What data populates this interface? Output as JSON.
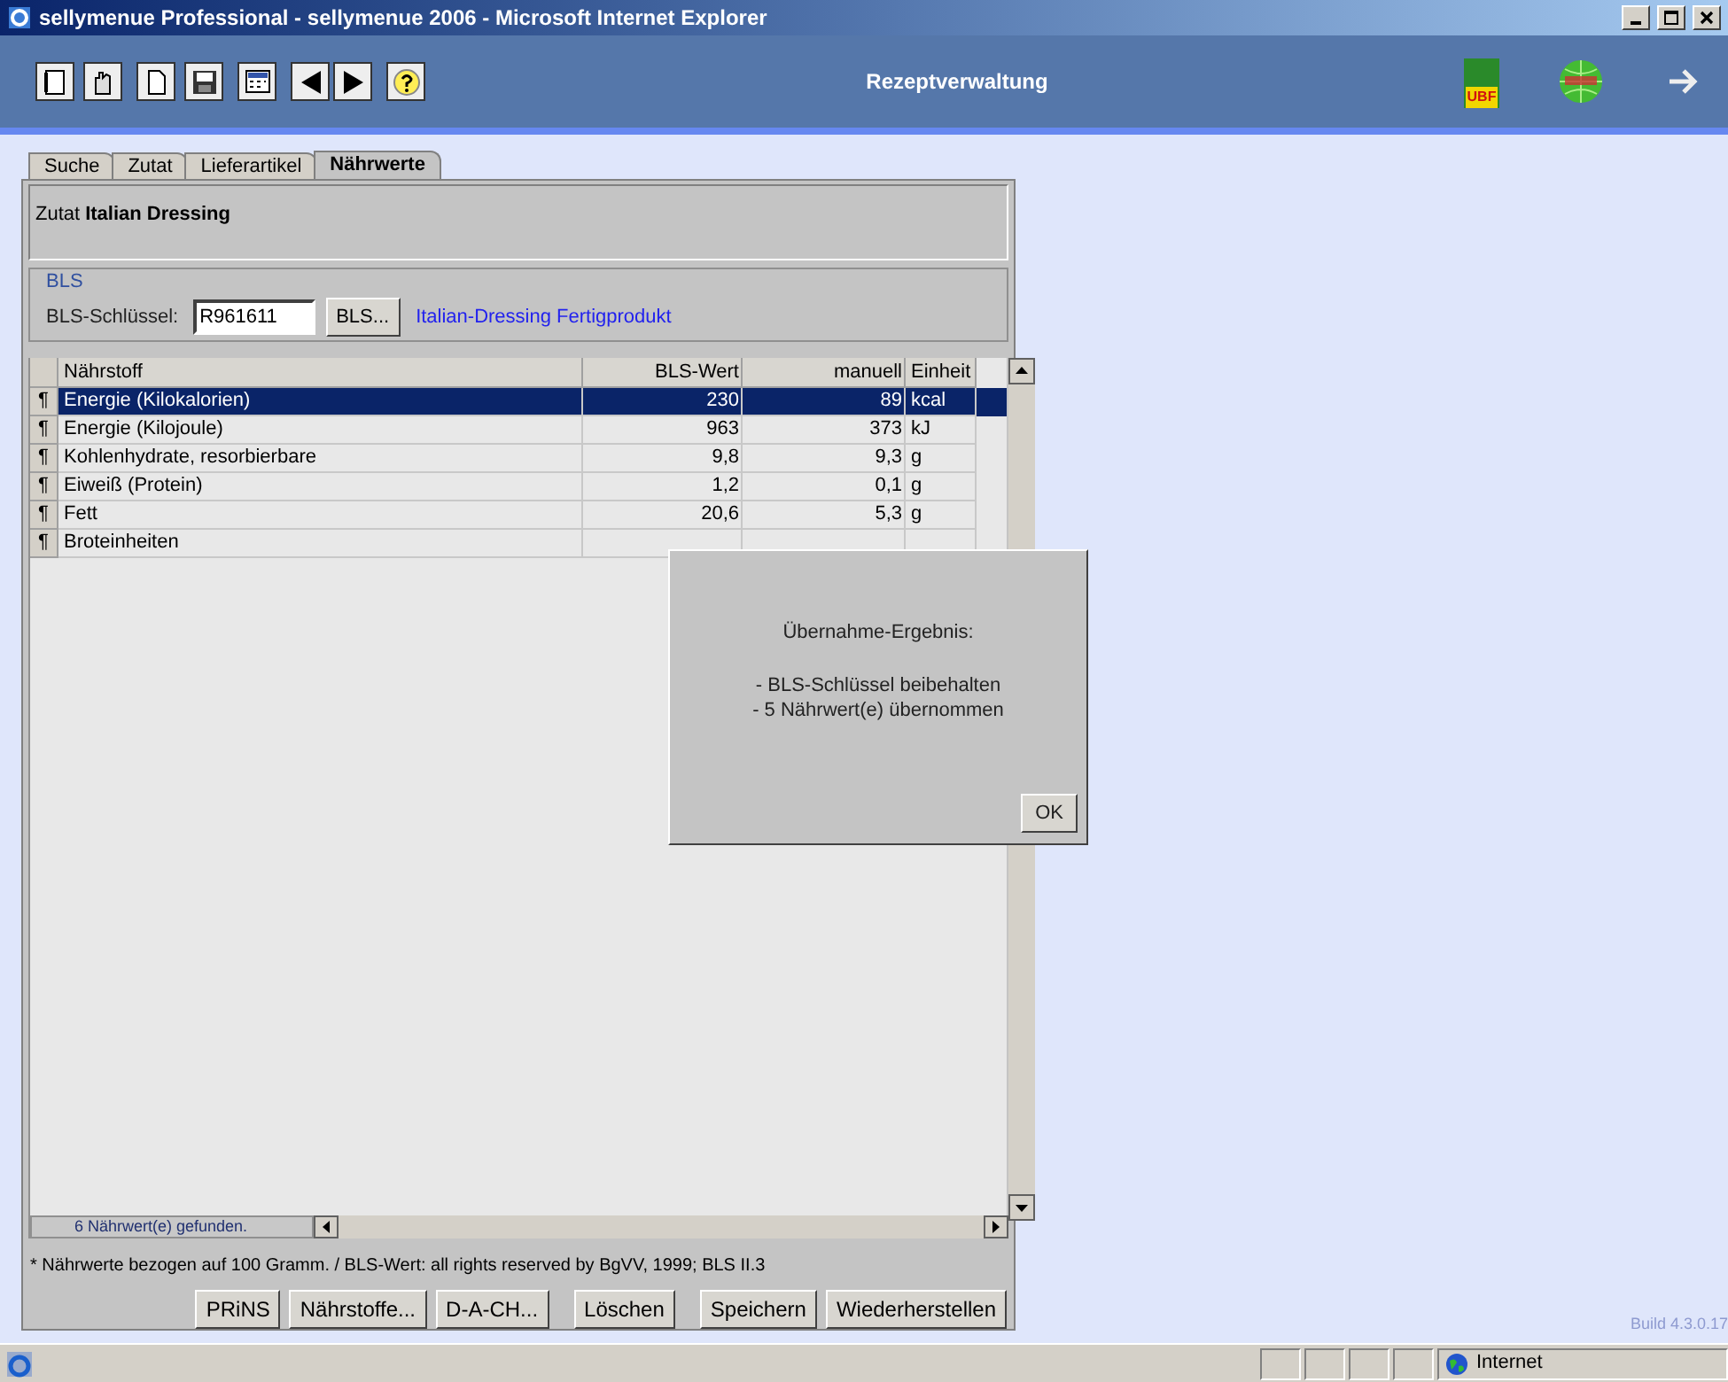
{
  "window": {
    "title": "sellymenue Professional - sellymenue 2006 - Microsoft Internet Explorer"
  },
  "header": {
    "title": "Rezeptverwaltung",
    "logo_text": "UBF"
  },
  "tabs": [
    {
      "label": "Suche",
      "selected": false
    },
    {
      "label": "Zutat",
      "selected": false
    },
    {
      "label": "Lieferartikel",
      "selected": false
    },
    {
      "label": "Nährwerte",
      "selected": true
    }
  ],
  "ingredient": {
    "label": "Zutat",
    "name": "Italian Dressing"
  },
  "bls": {
    "legend": "BLS",
    "key_label": "BLS-Schlüssel:",
    "key_value": "R961611",
    "button": "BLS...",
    "description": "Italian-Dressing Fertigprodukt"
  },
  "table": {
    "columns": [
      "Nährstoff",
      "BLS-Wert",
      "manuell",
      "Einheit"
    ],
    "rows": [
      {
        "marker": "¶",
        "name": "Energie (Kilokalorien)",
        "bls": "230",
        "manual": "89",
        "unit": "kcal",
        "selected": true
      },
      {
        "marker": "¶",
        "name": "Energie (Kilojoule)",
        "bls": "963",
        "manual": "373",
        "unit": "kJ",
        "selected": false
      },
      {
        "marker": "¶",
        "name": "Kohlenhydrate, resorbierbare",
        "bls": "9,8",
        "manual": "9,3",
        "unit": "g",
        "selected": false
      },
      {
        "marker": "¶",
        "name": "Eiweiß (Protein)",
        "bls": "1,2",
        "manual": "0,1",
        "unit": "g",
        "selected": false
      },
      {
        "marker": "¶",
        "name": "Fett",
        "bls": "20,6",
        "manual": "5,3",
        "unit": "g",
        "selected": false
      },
      {
        "marker": "¶",
        "name": "Broteinheiten",
        "selected": false
      }
    ],
    "count": "6  Nährwert(e) gefunden."
  },
  "footnote": "* Nährwerte bezogen auf 100 Gramm. / BLS-Wert: all rights reserved by BgVV, 1999; BLS II.3",
  "buttons": [
    "PRiNS",
    "Nährstoffe...",
    "D-A-CH...",
    "Löschen",
    "Speichern",
    "Wiederherstellen"
  ],
  "dialog": {
    "title": "Übernahme-Ergebnis:",
    "lines": [
      "- BLS-Schlüssel beibehalten",
      "- 5 Nährwert(e) übernommen"
    ],
    "button": "OK"
  },
  "build": "Build 4.3.0.17",
  "status_bar": {
    "zone": "Internet"
  }
}
